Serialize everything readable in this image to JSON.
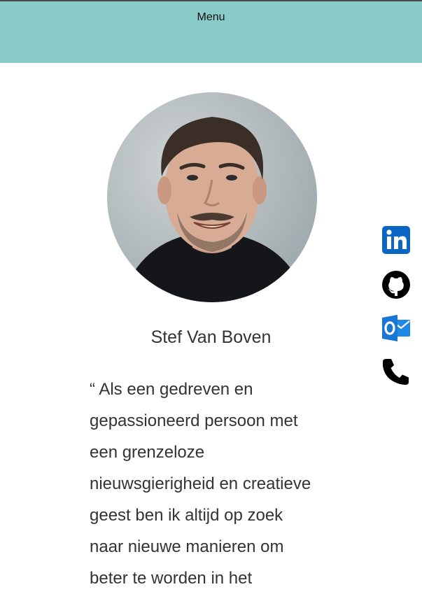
{
  "header": {
    "menu_label": "Menu",
    "background_color": "#88cbc9"
  },
  "profile": {
    "photo_alt": "Profile photo",
    "name": "Stef Van Boven",
    "quote_lines": [
      "“ Als een gedreven en",
      "gepassioneerd persoon met",
      "een grenzeloze",
      "nieuwsgierigheid en creatieve",
      "geest ben ik altijd op zoek",
      "naar nieuwe manieren om",
      "beter te worden in het"
    ]
  },
  "social_links": [
    {
      "icon": "linkedin-icon",
      "color": "#0a66c2"
    },
    {
      "icon": "github-icon",
      "color": "#000000"
    },
    {
      "icon": "outlook-icon",
      "color": "#1e88e5"
    },
    {
      "icon": "phone-icon",
      "color": "#000000"
    }
  ]
}
